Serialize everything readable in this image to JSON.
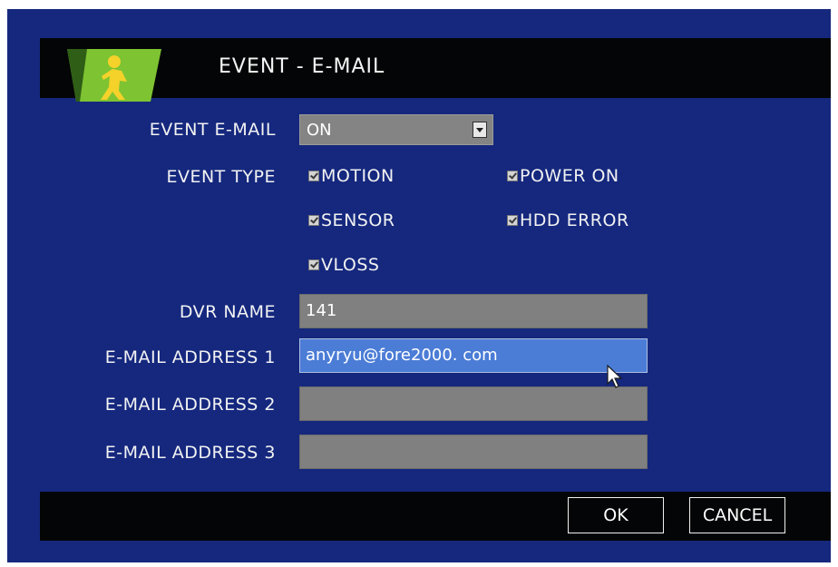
{
  "header": {
    "title": "EVENT - E-MAIL",
    "icon": "running-man-icon"
  },
  "event_email": {
    "label": "EVENT E-MAIL",
    "value": "ON"
  },
  "event_type": {
    "label": "EVENT TYPE",
    "options": [
      {
        "label": "MOTION",
        "checked": true
      },
      {
        "label": "POWER ON",
        "checked": true
      },
      {
        "label": "SENSOR",
        "checked": true
      },
      {
        "label": "HDD ERROR",
        "checked": true
      },
      {
        "label": "VLOSS",
        "checked": true
      }
    ]
  },
  "dvr_name": {
    "label": "DVR NAME",
    "value": "141"
  },
  "email_addresses": [
    {
      "label": "E-MAIL ADDRESS 1",
      "value": "anyryu@fore2000. com"
    },
    {
      "label": "E-MAIL ADDRESS 2",
      "value": ""
    },
    {
      "label": "E-MAIL ADDRESS 3",
      "value": ""
    }
  ],
  "buttons": {
    "ok": "OK",
    "cancel": "CANCEL"
  },
  "colors": {
    "background": "#15287e",
    "bar": "#040506",
    "field": "#808080",
    "field_active": "#4b7cd6",
    "icon_green": "#7ec332",
    "icon_yellow": "#f4d22a"
  }
}
